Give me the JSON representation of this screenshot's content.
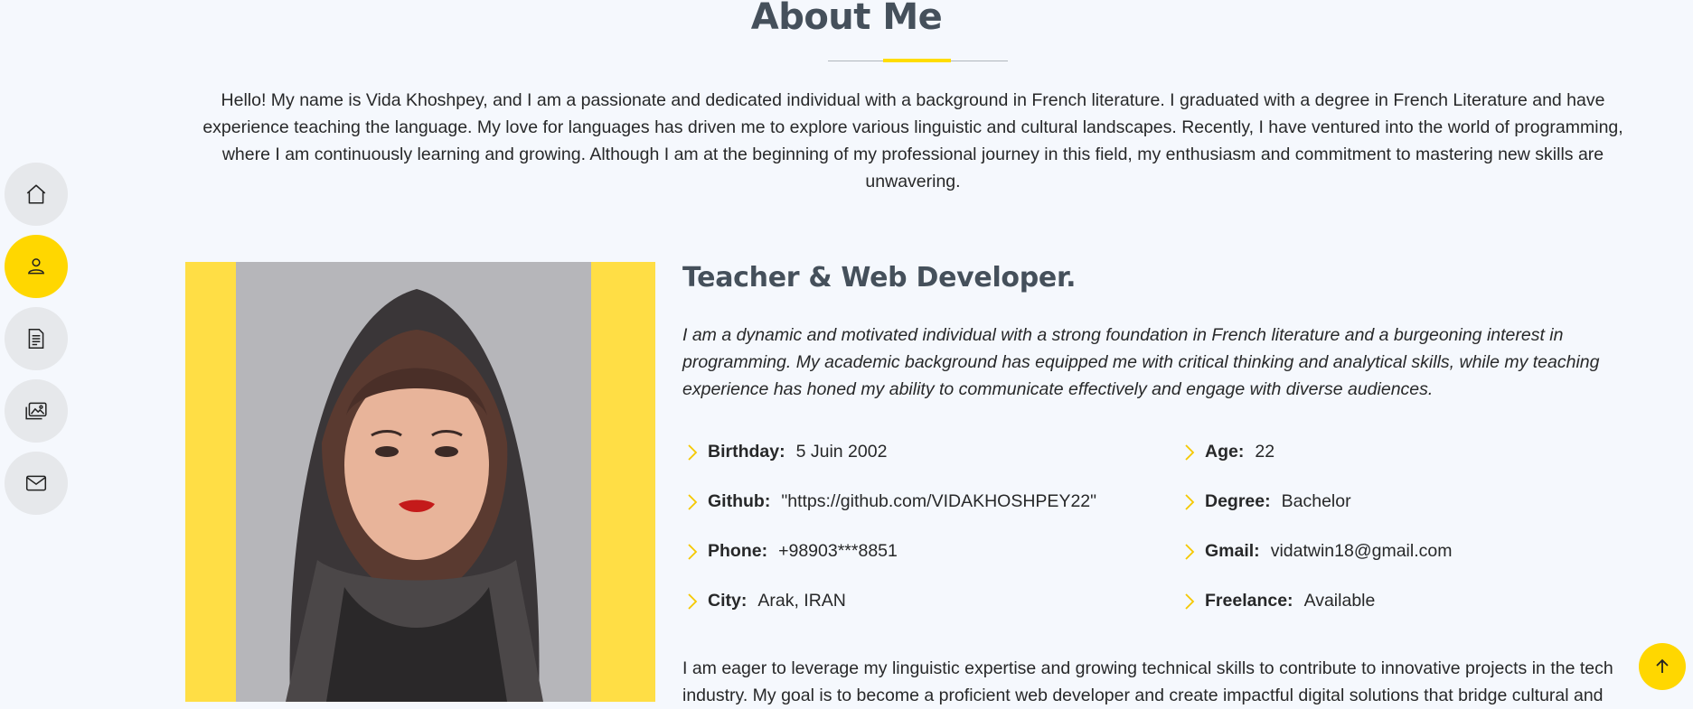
{
  "section": {
    "title": "About Me",
    "intro": "Hello! My name is Vida Khoshpey, and I am a passionate and dedicated individual with a background in French literature. I graduated with a degree in French Literature and have experience teaching the language. My love for languages has driven me to explore various linguistic and cultural landscapes. Recently, I have ventured into the world of programming, where I am continuously learning and growing. Although I am at the beginning of my professional journey in this field, my enthusiasm and commitment to mastering new skills are unwavering."
  },
  "nav": {
    "items": [
      {
        "icon": "home-icon",
        "active": false
      },
      {
        "icon": "person-icon",
        "active": true
      },
      {
        "icon": "resume-icon",
        "active": false
      },
      {
        "icon": "images-icon",
        "active": false
      },
      {
        "icon": "envelope-icon",
        "active": false
      }
    ]
  },
  "profile": {
    "role": "Teacher & Web Developer.",
    "summary": "I am a dynamic and motivated individual with a strong foundation in French literature and a burgeoning interest in programming. My academic background has equipped me with critical thinking and analytical skills, while my teaching experience has honed my ability to communicate effectively and engage with diverse audiences.",
    "info": [
      {
        "label": "Birthday:",
        "value": "5 Juin 2002"
      },
      {
        "label": "Age:",
        "value": "22"
      },
      {
        "label": "Github:",
        "value": "\"https://github.com/VIDAKHOSHPEY22\""
      },
      {
        "label": "Degree:",
        "value": "Bachelor"
      },
      {
        "label": "Phone:",
        "value": "+98903***8851"
      },
      {
        "label": "Gmail:",
        "value": "vidatwin18@gmail.com"
      },
      {
        "label": "City:",
        "value": "Arak, IRAN"
      },
      {
        "label": "Freelance:",
        "value": "Available"
      }
    ],
    "closing": "I am eager to leverage my linguistic expertise and growing technical skills to contribute to innovative projects in the tech industry. My goal is to become a proficient web developer and create impactful digital solutions that bridge cultural and"
  },
  "colors": {
    "accent": "#ffd700",
    "heading": "#45505b",
    "photo_frame": "#ffde45"
  }
}
